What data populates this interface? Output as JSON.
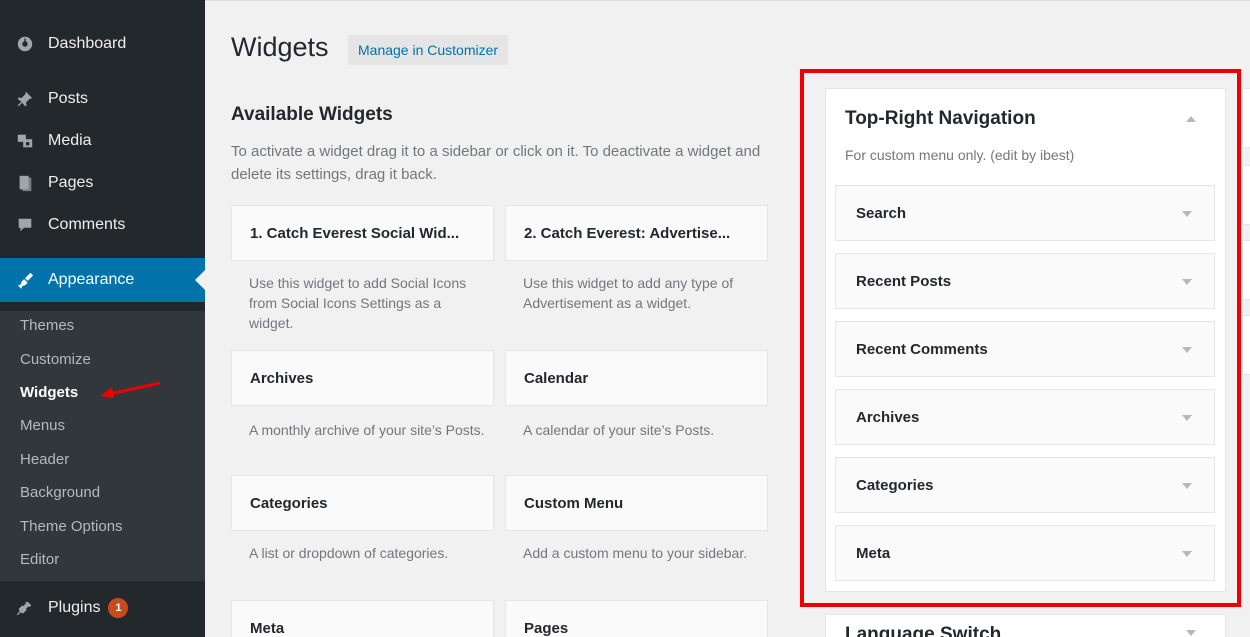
{
  "sidebar": {
    "items": [
      {
        "label": "Dashboard",
        "icon": "dashboard-icon"
      },
      {
        "label": "Posts",
        "icon": "pin-icon"
      },
      {
        "label": "Media",
        "icon": "media-icon"
      },
      {
        "label": "Pages",
        "icon": "pages-icon"
      },
      {
        "label": "Comments",
        "icon": "comment-icon"
      },
      {
        "label": "Appearance",
        "icon": "brush-icon"
      },
      {
        "label": "Plugins",
        "icon": "plugin-icon",
        "badge": "1"
      }
    ],
    "submenu": [
      "Themes",
      "Customize",
      "Widgets",
      "Menus",
      "Header",
      "Background",
      "Theme Options",
      "Editor"
    ],
    "active_submenu": "Widgets"
  },
  "header": {
    "title": "Widgets",
    "customizer_button": "Manage in Customizer"
  },
  "available": {
    "title": "Available Widgets",
    "description": "To activate a widget drag it to a sidebar or click on it. To deactivate a widget and delete its settings, drag it back.",
    "widgets": [
      {
        "name": "1. Catch Everest Social Wid...",
        "desc": "Use this widget to add Social Icons from Social Icons Settings as a widget."
      },
      {
        "name": "2. Catch Everest: Advertise...",
        "desc": "Use this widget to add any type of Advertisement as a widget."
      },
      {
        "name": "Archives",
        "desc": "A monthly archive of your site’s Posts."
      },
      {
        "name": "Calendar",
        "desc": "A calendar of your site’s Posts."
      },
      {
        "name": "Categories",
        "desc": "A list or dropdown of categories."
      },
      {
        "name": "Custom Menu",
        "desc": "Add a custom menu to your sidebar."
      },
      {
        "name": "Meta",
        "desc": ""
      },
      {
        "name": "Pages",
        "desc": ""
      }
    ]
  },
  "widget_area": {
    "title": "Top-Right Navigation",
    "description": "For custom menu only. (edit by ibest)",
    "widgets": [
      "Search",
      "Recent Posts",
      "Recent Comments",
      "Archives",
      "Categories",
      "Meta"
    ]
  },
  "next_area": {
    "title": "Language Switch"
  },
  "colors": {
    "sidebar_bg": "#23282d",
    "accent": "#0073aa",
    "highlight_frame": "#ee0000"
  }
}
